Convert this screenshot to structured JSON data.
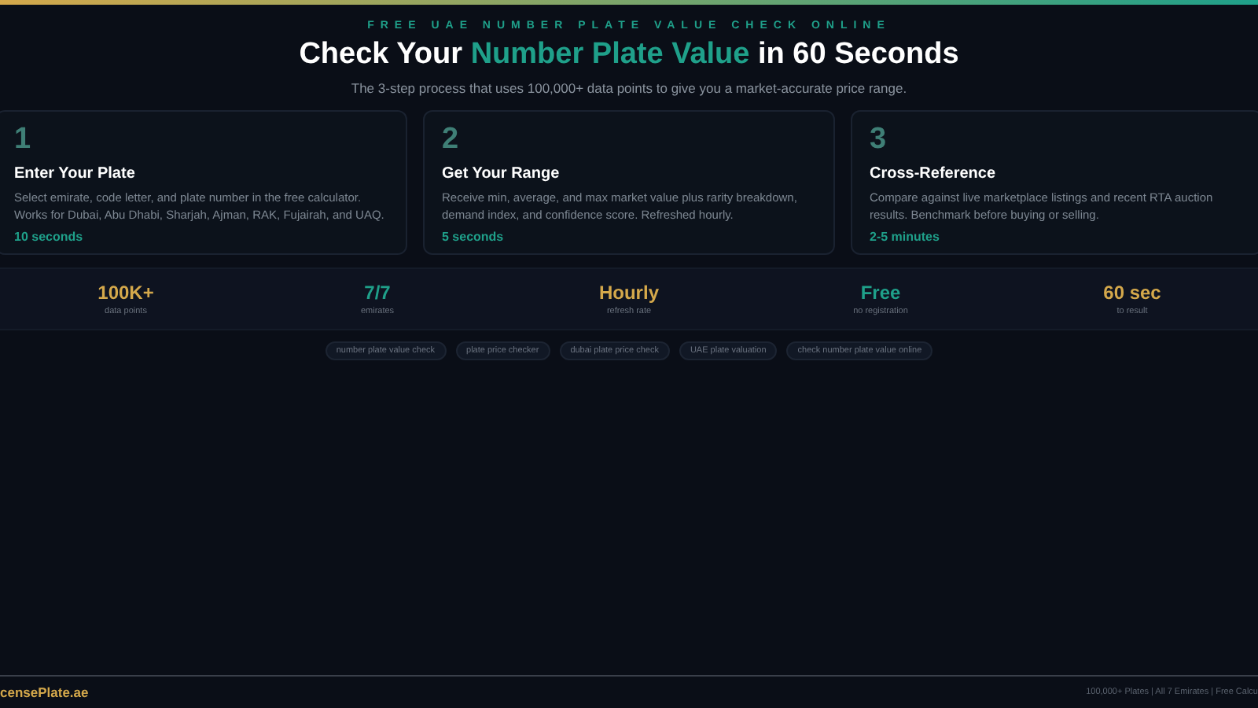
{
  "header": {
    "eyebrow": "FREE UAE NUMBER PLATE VALUE CHECK ONLINE",
    "title": {
      "before": "Check Your ",
      "highlight": "Number Plate Value",
      "after": " in 60 Seconds"
    },
    "subtitle": "The 3-step process that uses 100,000+ data points to give you a market-accurate price range."
  },
  "steps": [
    {
      "number": "1",
      "title": "Enter Your Plate",
      "description": "Select emirate, code letter, and plate number in the free calculator. Works for Dubai, Abu Dhabi, Sharjah, Ajman, RAK, Fujairah, and UAQ.",
      "time": "10 seconds"
    },
    {
      "number": "2",
      "title": "Get Your Range",
      "description": "Receive min, average, and max market value plus rarity breakdown, demand index, and confidence score. Refreshed hourly.",
      "time": "5 seconds"
    },
    {
      "number": "3",
      "title": "Cross-Reference",
      "description": "Compare against live marketplace listings and recent RTA auction results. Benchmark before buying or selling.",
      "time": "2-5 minutes"
    }
  ],
  "stats": [
    {
      "value": "100K+",
      "label": "data points",
      "color": "#d4a84b"
    },
    {
      "value": "7/7",
      "label": "emirates",
      "color": "#1fa08a"
    },
    {
      "value": "Hourly",
      "label": "refresh rate",
      "color": "#d4a84b"
    },
    {
      "value": "Free",
      "label": "no registration",
      "color": "#1fa08a"
    },
    {
      "value": "60 sec",
      "label": "to result",
      "color": "#d4a84b"
    }
  ],
  "tags": [
    "number plate value check",
    "plate price checker",
    "dubai plate price check",
    "UAE plate valuation",
    "check number plate value online"
  ],
  "footer": {
    "brand": "censePlate.ae",
    "info": "100,000+ Plates | All 7 Emirates | Free Calcu"
  }
}
